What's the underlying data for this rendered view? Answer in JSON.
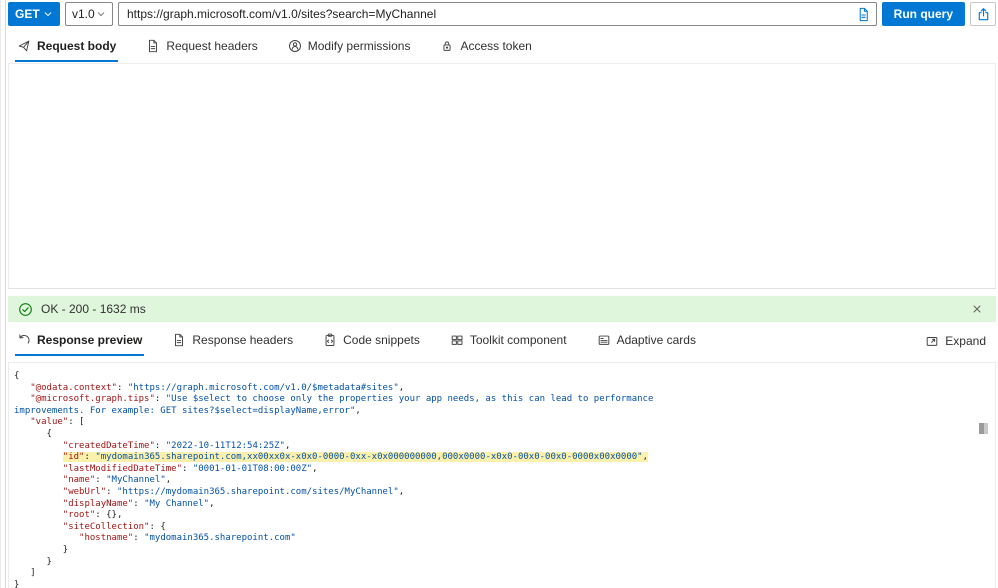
{
  "request_bar": {
    "method": "GET",
    "version": "v1.0",
    "url": "https://graph.microsoft.com/v1.0/sites?search=MyChannel",
    "run_button": "Run query"
  },
  "request_tabs": [
    {
      "label": "Request body",
      "icon": "send-icon",
      "selected": true
    },
    {
      "label": "Request headers",
      "icon": "document-icon",
      "selected": false
    },
    {
      "label": "Modify permissions",
      "icon": "person-permissions-icon",
      "selected": false
    },
    {
      "label": "Access token",
      "icon": "lock-icon",
      "selected": false
    }
  ],
  "status_bar": {
    "text": "OK - 200 - 1632 ms",
    "icon": "check-circle-icon"
  },
  "response_tabs": [
    {
      "label": "Response preview",
      "icon": "undo-icon",
      "selected": true
    },
    {
      "label": "Response headers",
      "icon": "document-icon",
      "selected": false
    },
    {
      "label": "Code snippets",
      "icon": "code-snippets-icon",
      "selected": false
    },
    {
      "label": "Toolkit component",
      "icon": "grid-icon",
      "selected": false
    },
    {
      "label": "Adaptive cards",
      "icon": "card-icon",
      "selected": false
    }
  ],
  "expand_button": {
    "label": "Expand",
    "icon": "expand-icon"
  },
  "colors": {
    "accent": "#0078d4",
    "status_bg": "#dff6dd",
    "status_icon": "#107c10",
    "json_key": "#a31515",
    "json_string": "#0451a5",
    "highlight_bg": "#fbf1ad"
  },
  "response_json": {
    "lines": [
      {
        "segs": [
          {
            "c": "plain",
            "t": "{"
          }
        ]
      },
      {
        "segs": [
          {
            "c": "plain",
            "t": "   "
          },
          {
            "c": "key",
            "t": "\"@odata.context\""
          },
          {
            "c": "plain",
            "t": ": "
          },
          {
            "c": "str",
            "t": "\"https://graph.microsoft.com/v1.0/$metadata#sites\""
          },
          {
            "c": "plain",
            "t": ","
          }
        ]
      },
      {
        "segs": [
          {
            "c": "plain",
            "t": "   "
          },
          {
            "c": "key",
            "t": "\"@microsoft.graph.tips\""
          },
          {
            "c": "plain",
            "t": ": "
          },
          {
            "c": "str",
            "t": "\"Use $select to choose only the properties your app needs, as this can lead to performance"
          }
        ]
      },
      {
        "segs": [
          {
            "c": "str",
            "t": "improvements. For example: GET sites?$select=displayName,error\""
          },
          {
            "c": "plain",
            "t": ","
          }
        ]
      },
      {
        "segs": [
          {
            "c": "plain",
            "t": "   "
          },
          {
            "c": "key",
            "t": "\"value\""
          },
          {
            "c": "plain",
            "t": ": ["
          }
        ]
      },
      {
        "segs": [
          {
            "c": "plain",
            "t": "      {"
          }
        ]
      },
      {
        "segs": [
          {
            "c": "plain",
            "t": "         "
          },
          {
            "c": "key",
            "t": "\"createdDateTime\""
          },
          {
            "c": "plain",
            "t": ": "
          },
          {
            "c": "str",
            "t": "\"2022-10-11T12:54:25Z\""
          },
          {
            "c": "plain",
            "t": ","
          }
        ]
      },
      {
        "segs": [
          {
            "c": "plain",
            "t": "         "
          },
          {
            "c": "key",
            "t": "\"id\"",
            "hl": true
          },
          {
            "c": "plain",
            "t": ": ",
            "hl": true
          },
          {
            "c": "str",
            "t": "\"mydomain365.sharepoint.com,xx00xx0x-x0x0-0000-0xx-x0x000000000,000x0000-x0x0-00x0-00x0-0000x00x0000\"",
            "hl": true
          },
          {
            "c": "plain",
            "t": ",",
            "hl": true
          }
        ]
      },
      {
        "segs": [
          {
            "c": "plain",
            "t": "         "
          },
          {
            "c": "key",
            "t": "\"lastModifiedDateTime\""
          },
          {
            "c": "plain",
            "t": ": "
          },
          {
            "c": "str",
            "t": "\"0001-01-01T08:00:00Z\""
          },
          {
            "c": "plain",
            "t": ","
          }
        ]
      },
      {
        "segs": [
          {
            "c": "plain",
            "t": "         "
          },
          {
            "c": "key",
            "t": "\"name\""
          },
          {
            "c": "plain",
            "t": ": "
          },
          {
            "c": "str",
            "t": "\"MyChannel\""
          },
          {
            "c": "plain",
            "t": ","
          }
        ]
      },
      {
        "segs": [
          {
            "c": "plain",
            "t": "         "
          },
          {
            "c": "key",
            "t": "\"webUrl\""
          },
          {
            "c": "plain",
            "t": ": "
          },
          {
            "c": "str",
            "t": "\"https://mydomain365.sharepoint.com/sites/MyChannel\""
          },
          {
            "c": "plain",
            "t": ","
          }
        ]
      },
      {
        "segs": [
          {
            "c": "plain",
            "t": "         "
          },
          {
            "c": "key",
            "t": "\"displayName\""
          },
          {
            "c": "plain",
            "t": ": "
          },
          {
            "c": "str",
            "t": "\"My Channel\""
          },
          {
            "c": "plain",
            "t": ","
          }
        ]
      },
      {
        "segs": [
          {
            "c": "plain",
            "t": "         "
          },
          {
            "c": "key",
            "t": "\"root\""
          },
          {
            "c": "plain",
            "t": ": {},"
          }
        ]
      },
      {
        "segs": [
          {
            "c": "plain",
            "t": "         "
          },
          {
            "c": "key",
            "t": "\"siteCollection\""
          },
          {
            "c": "plain",
            "t": ": {"
          }
        ]
      },
      {
        "segs": [
          {
            "c": "plain",
            "t": "            "
          },
          {
            "c": "key",
            "t": "\"hostname\""
          },
          {
            "c": "plain",
            "t": ": "
          },
          {
            "c": "str",
            "t": "\"mydomain365.sharepoint.com\""
          }
        ]
      },
      {
        "segs": [
          {
            "c": "plain",
            "t": "         }"
          }
        ]
      },
      {
        "segs": [
          {
            "c": "plain",
            "t": "      }"
          }
        ]
      },
      {
        "segs": [
          {
            "c": "plain",
            "t": "   ]"
          }
        ]
      },
      {
        "segs": [
          {
            "c": "plain",
            "t": "}"
          }
        ]
      }
    ]
  }
}
